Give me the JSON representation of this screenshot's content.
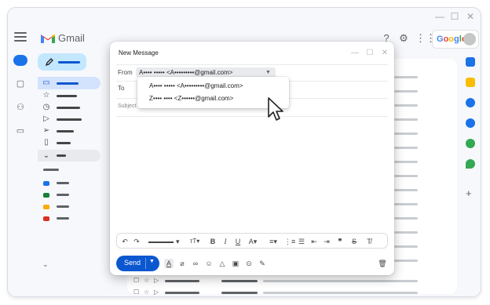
{
  "app": {
    "brand": "Gmail",
    "search_brand": "Google"
  },
  "compose": {
    "title": "New Message",
    "from_label": "From",
    "from_value": "A•••• ••••• <A•••••••••@gmail.com>",
    "to_label": "To",
    "subject_placeholder": "Subject",
    "suggestions": [
      "A•••• ••••• <A•••••••••@gmail.com>",
      "Z•••• •••• <Z••••••@gmail.com>"
    ],
    "send_label": "Send"
  },
  "colors": {
    "accent": "#0b57d0",
    "compose_button": "#c2e7ff",
    "label_colors": [
      "#1a73e8",
      "#188038",
      "#f9ab00",
      "#d93025"
    ]
  },
  "icons": {
    "header": [
      "help-icon",
      "settings-icon",
      "apps-icon"
    ],
    "side_panel": [
      "calendar-icon",
      "keep-icon",
      "tasks-icon",
      "contacts-icon",
      "meet-icon",
      "maps-icon",
      "add-icon"
    ],
    "format_toolbar": [
      "undo-icon",
      "redo-icon",
      "font-family-icon",
      "font-size-icon",
      "bold-icon",
      "italic-icon",
      "underline-icon",
      "text-color-icon",
      "align-icon",
      "numbered-list-icon",
      "bulleted-list-icon",
      "indent-less-icon",
      "indent-more-icon",
      "quote-icon",
      "strikethrough-icon",
      "clear-formatting-icon"
    ],
    "bottom_toolbar": [
      "formatting-options-icon",
      "attach-icon",
      "link-icon",
      "emoji-icon",
      "drive-icon",
      "photo-icon",
      "confidential-icon",
      "signature-icon",
      "trash-icon"
    ]
  }
}
